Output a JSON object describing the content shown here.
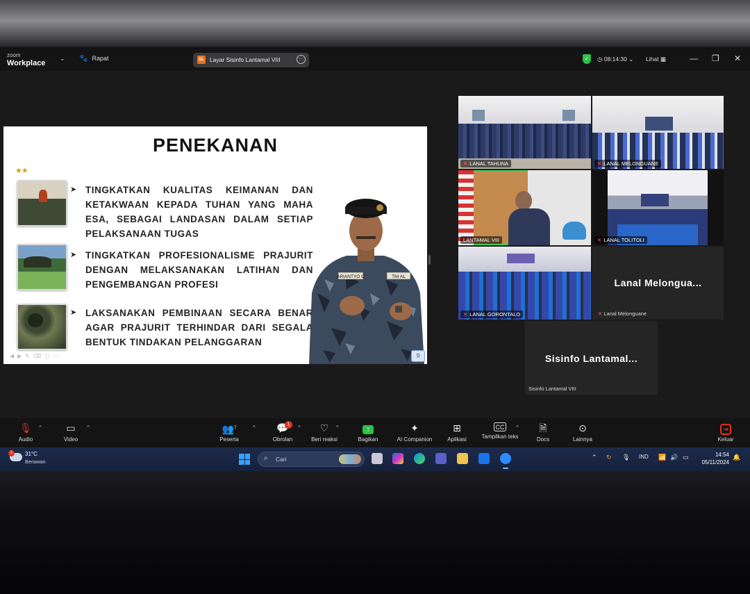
{
  "app": {
    "brand_small": "zoom",
    "brand": "Workplace",
    "meeting_type": "Rapat",
    "share_badge": "SL",
    "share_title": "Layar Sisinfo Lantamal VIII",
    "timer": "08:14:30",
    "view_label": "Lihat"
  },
  "slide": {
    "title": "PENEKANAN",
    "bullets": [
      "TINGKATKAN KUALITAS KEIMANAN DAN KETAKWAAN KEPADA TUHAN YANG MAHA ESA, SEBAGAI LANDASAN DALAM SETIAP PELAKSANAAN TUGAS",
      "TINGKATKAN PROFESIONALISME PRAJURIT DENGAN MELAKSANAKAN LATIHAN DAN PENGEMBANGAN PROFESI",
      "LAKSANAKAN PEMBINAAN SECARA BENAR AGAR PRAJURIT TERHINDAR DARI SEGALA BENTUK TINDAKAN PELANGGARAN"
    ],
    "name_tag": "ARIANTYO C",
    "unit_tag": "TNI AL",
    "page_number": "9"
  },
  "participants": [
    {
      "name": "LANAL TAHUNA"
    },
    {
      "name": "LANAL MELONGUANE"
    },
    {
      "name": "LANTAMAL VIII"
    },
    {
      "name": "LANAL TOLITOLI"
    },
    {
      "name": "LANAL GORONTALO"
    }
  ],
  "name_tiles": [
    {
      "display": "Lanal Melongua...",
      "sub": "Lanal Melonguane"
    },
    {
      "display": "Sisinfo Lantamal...",
      "sub": "Sisinfo Lantamal VIII"
    }
  ],
  "toolbar": {
    "audio": "Audio",
    "video": "Video",
    "participants": "Peserta",
    "participants_count": "7",
    "chat": "Obrolan",
    "chat_badge": "1",
    "react": "Beri reaksi",
    "share": "Bagikan",
    "ai": "AI Companion",
    "apps": "Aplikasi",
    "captions": "Tampilkan teks",
    "docs": "Docs",
    "more": "Lainnya",
    "leave": "Keluar"
  },
  "taskbar": {
    "weather_temp": "31°C",
    "weather_desc": "Berawan",
    "weather_badge": "1",
    "search_placeholder": "Cari",
    "language": "IND",
    "time": "14:54",
    "date": "05/11/2024"
  }
}
